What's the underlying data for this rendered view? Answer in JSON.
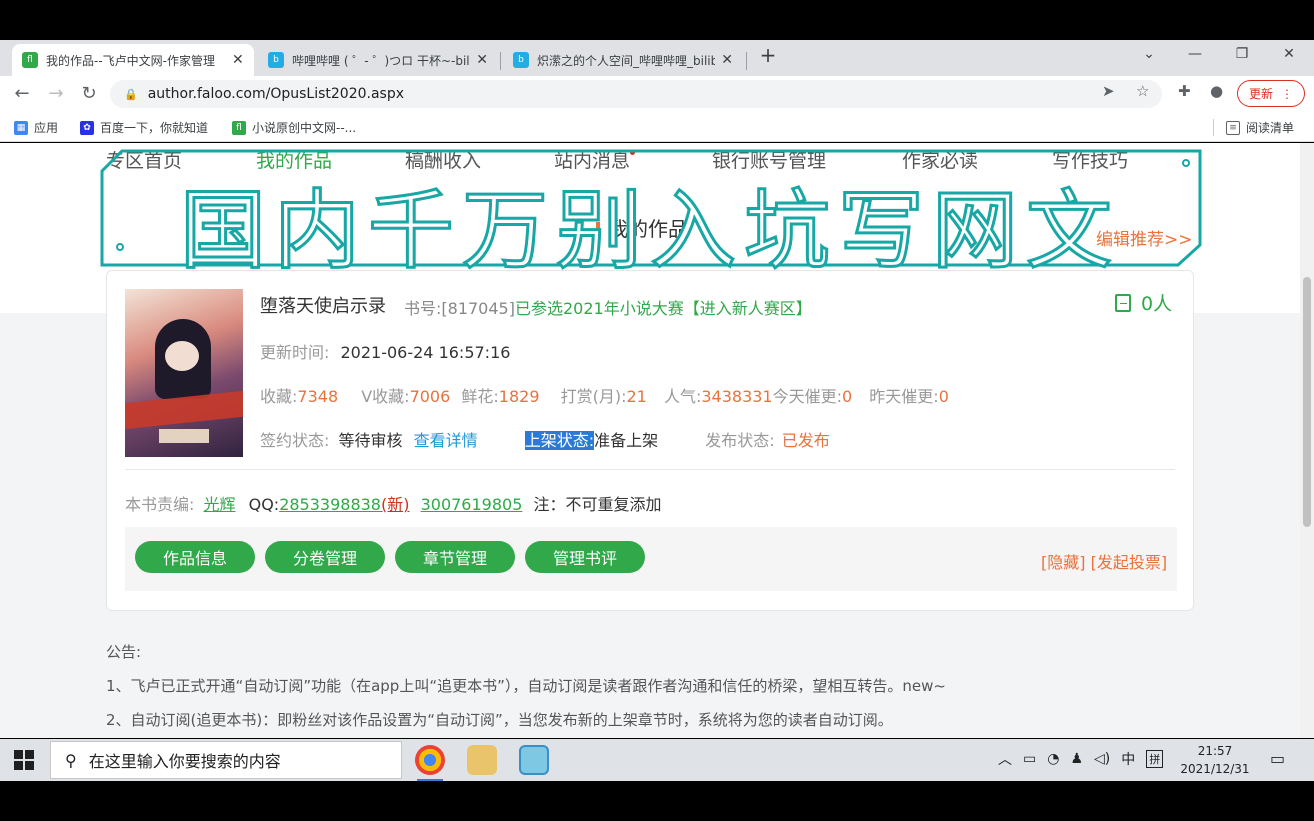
{
  "browser": {
    "tabs": [
      {
        "title": "我的作品--飞卢中文网-作家管理",
        "active": true
      },
      {
        "title": "哔哩哔哩 ( ゜- ゜)つロ 干杯~-bilibili",
        "active": false
      },
      {
        "title": "炽潆之的个人空间_哔哩哔哩_bilibili",
        "active": false
      }
    ],
    "new_tab": "+",
    "url": "author.faloo.com/OpusList2020.aspx",
    "update_label": "更新",
    "bookmarks": [
      "应用",
      "百度一下，你就知道",
      "小说原创中文网--..."
    ],
    "reading_list": "阅读清单"
  },
  "site": {
    "nav": [
      {
        "label": "专区首页",
        "current": false
      },
      {
        "label": "我的作品",
        "current": true
      },
      {
        "label": "稿酬收入",
        "current": false
      },
      {
        "label": "站内消息",
        "current": false
      },
      {
        "label": "银行账号管理",
        "current": false
      },
      {
        "label": "作家必读",
        "current": false
      },
      {
        "label": "写作技巧",
        "current": false
      }
    ],
    "section_title": "我的作品",
    "editor_recommend": "编辑推荐>>"
  },
  "overlay_caption": "国内千万别入坑写网文",
  "book": {
    "title": "堕落天使启示录",
    "meta_prefix": "书号:[817045]",
    "meta_contest": "已参选2021年小说大赛【进入新人赛区】",
    "followers": "0人",
    "update_label": "更新时间:",
    "update_time": "2021-06-24 16:57:16",
    "stats": {
      "collect_label": "收藏:",
      "collect": "7348",
      "vcollect_label": "V收藏:",
      "vcollect": "7006",
      "flowers_label": "鲜花:",
      "flowers": "1829",
      "tip_label": "打赏(月):",
      "tip": "21",
      "popularity_label": "人气:",
      "popularity": "3438331",
      "today_label": "今天催更:",
      "today": "0",
      "yesterday_label": "昨天催更:",
      "yesterday": "0"
    },
    "sign_label": "签约状态:",
    "sign_value": "等待审核",
    "sign_link": "查看详情",
    "shelf_label": "上架状态:",
    "shelf_value": "准备上架",
    "publish_label": "发布状态:",
    "publish_value": "已发布",
    "editor_label": "本书责编:",
    "editor_name": "光辉",
    "qq_label": "QQ:",
    "qq1": "2853398838",
    "qq1_new": "(新)",
    "qq2": "3007619805",
    "note": "注：不可重复添加",
    "buttons": [
      "作品信息",
      "分卷管理",
      "章节管理",
      "管理书评"
    ],
    "hide_link": "[隐藏]",
    "vote_link": "[发起投票]"
  },
  "notice": {
    "title": "公告:",
    "items": [
      "1、飞卢已正式开通“自动订阅”功能（在app上叫“追更本书”），自动订阅是读者跟作者沟通和信任的桥梁，望相互转告。new~",
      "2、自动订阅(追更本书)：即粉丝对该作品设置为“自动订阅”，当您发布新的上架章节时，系统将为您的读者自动订阅。"
    ]
  },
  "taskbar": {
    "search_placeholder": "在这里输入你要搜索的内容",
    "ime": "中",
    "ime2": "拼",
    "time": "21:57",
    "date": "2021/12/31"
  },
  "colors": {
    "accent": "#31a84a",
    "orange": "#e9733d",
    "overlay_stroke": "#17a7a4"
  }
}
